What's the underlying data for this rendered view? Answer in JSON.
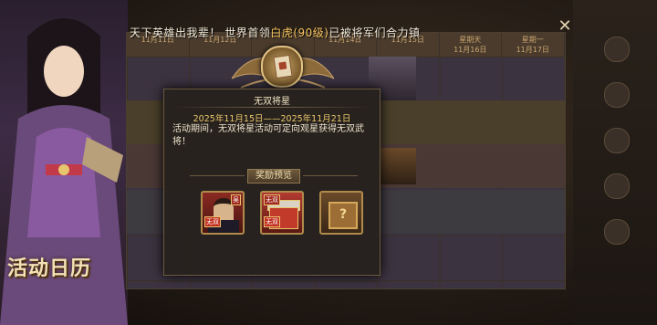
{
  "marquee": {
    "prefix": "天下英雄出我辈！ 世界首领",
    "boss": "白虎(90级)",
    "suffix": "已被将军们合力镇"
  },
  "calendar": {
    "days": [
      {
        "weekday": "",
        "date": "11月11日"
      },
      {
        "weekday": "",
        "date": "11月12日"
      },
      {
        "weekday": "",
        "date": ""
      },
      {
        "weekday": "",
        "date": "11月14日"
      },
      {
        "weekday": "",
        "date": "11月15日"
      },
      {
        "weekday": "星期天",
        "date": "11月16日"
      },
      {
        "weekday": "星期一",
        "date": "11月17日"
      }
    ]
  },
  "left_panel": {
    "title": "活动日历"
  },
  "popup": {
    "title": "无双将星",
    "dates": "2025年11月15日——2025年11月21日",
    "description": "活动期间，无双将星活动可定向观星获得无双武将！",
    "reward_label": "奖励预览",
    "rewards": [
      {
        "name": "hero",
        "tag_top": "吴",
        "tag_bottom": "无双"
      },
      {
        "name": "hero-chest",
        "tag_top": "无双",
        "tag_bottom": "无双"
      },
      {
        "name": "mystery-box",
        "symbol": "?"
      }
    ]
  },
  "close_label": "✕",
  "colors": {
    "accent_gold": "#e9c76a",
    "highlight": "#f7c460",
    "popup_bg": "#26211e"
  }
}
